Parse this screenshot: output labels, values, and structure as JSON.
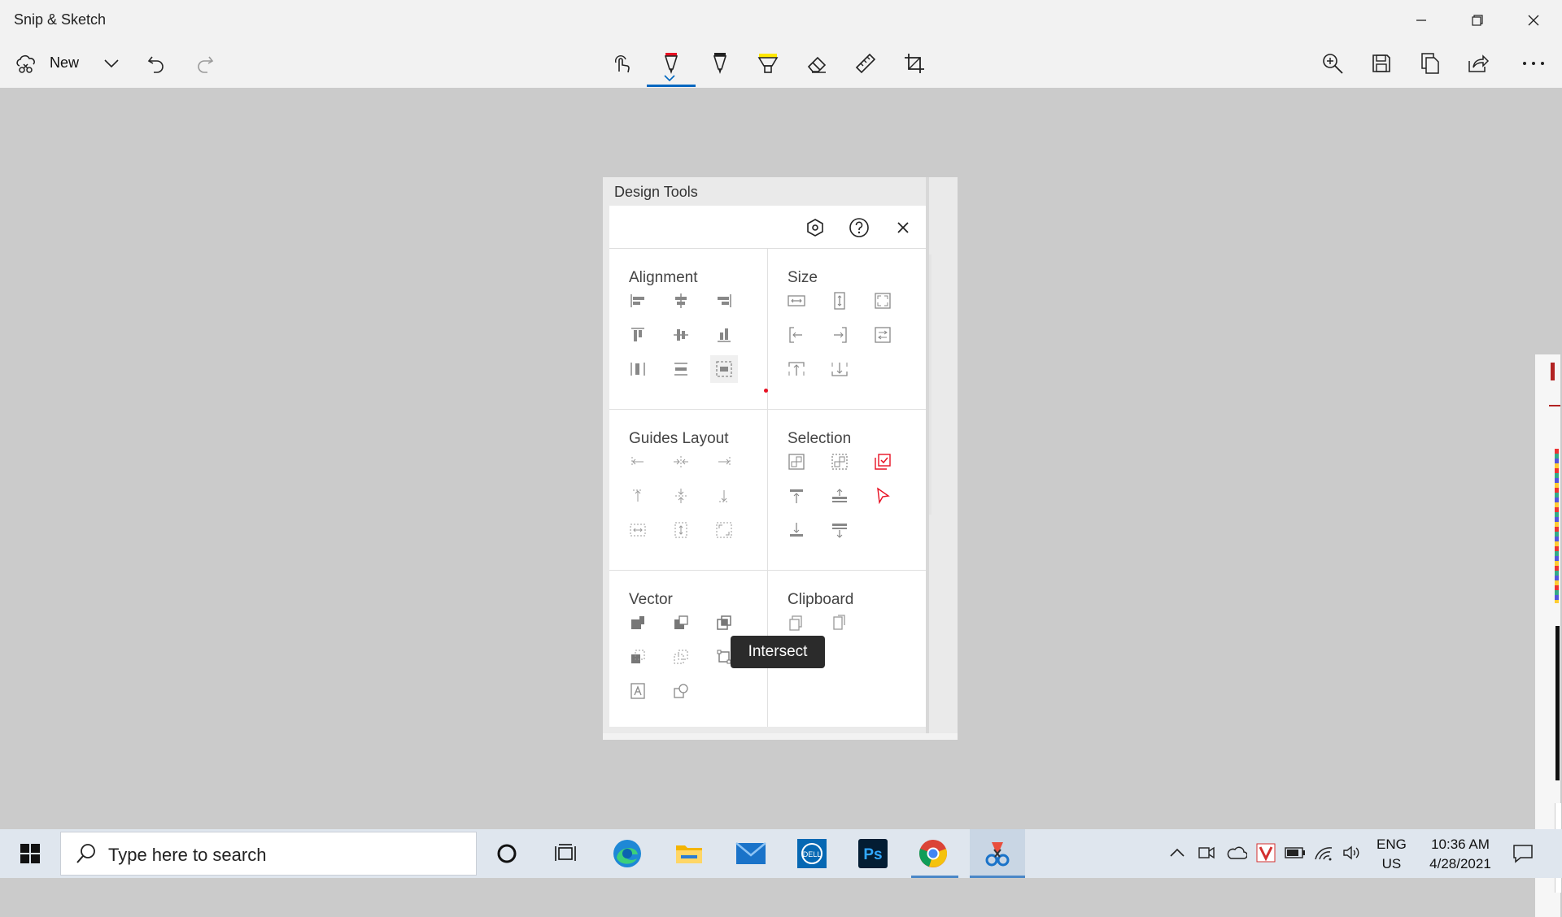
{
  "app": {
    "title": "Snip & Sketch",
    "new_label": "New"
  },
  "window_buttons": {
    "minimize": "minimize-icon",
    "maximize": "restore-icon",
    "close": "close-icon"
  },
  "toolbar": {
    "left": [
      "new-snip-icon",
      "chevron-down-icon",
      "undo-icon",
      "redo-icon"
    ],
    "center": [
      "touch-writing-icon",
      "ballpoint-pen-icon",
      "pencil-icon",
      "highlighter-icon",
      "eraser-icon",
      "ruler-icon",
      "crop-icon"
    ],
    "right": [
      "zoom-icon",
      "save-icon",
      "copy-icon",
      "share-icon",
      "more-icon"
    ],
    "active_tool": "ballpoint-pen-icon",
    "colors": {
      "pen": "#e81123",
      "highlighter": "#ffe800",
      "accent": "#0067c0"
    }
  },
  "design_tools": {
    "title": "Design Tools",
    "header_icons": [
      "settings-icon",
      "help-icon",
      "close-icon"
    ],
    "sections": {
      "alignment": {
        "title": "Alignment"
      },
      "size": {
        "title": "Size"
      },
      "guides_layout": {
        "title": "Guides Layout"
      },
      "selection": {
        "title": "Selection"
      },
      "vector": {
        "title": "Vector"
      },
      "clipboard": {
        "title": "Clipboard"
      }
    },
    "tooltip": "Intersect"
  },
  "taskbar": {
    "search_placeholder": "Type here to search",
    "apps": [
      "cortana-icon",
      "task-view-icon",
      "edge-icon",
      "file-explorer-icon",
      "mail-icon",
      "dell-icon",
      "photoshop-icon",
      "chrome-icon",
      "snip-sketch-icon"
    ],
    "tray_icons": [
      "chevron-up-icon",
      "meet-now-icon",
      "onedrive-icon",
      "vivaldi-icon",
      "battery-icon",
      "wifi-icon",
      "volume-icon"
    ],
    "lang_line1": "ENG",
    "lang_line2": "US",
    "time": "10:36 AM",
    "date": "4/28/2021",
    "notification_icon": "notification-icon"
  }
}
